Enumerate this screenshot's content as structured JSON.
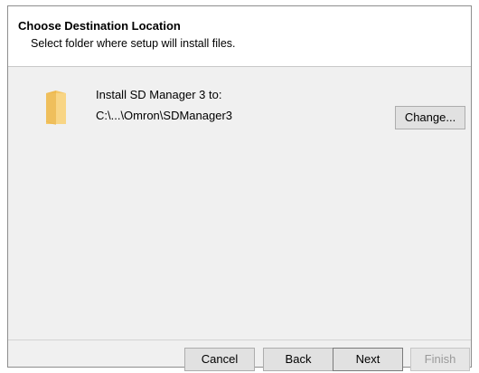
{
  "header": {
    "title": "Choose Destination Location",
    "subtitle": "Select folder where setup will install files."
  },
  "destination": {
    "label": "Install SD Manager 3 to:",
    "path": "C:\\...\\Omron\\SDManager3",
    "change_button": "Change...",
    "folder_icon": "folder-icon"
  },
  "footer": {
    "cancel": "Cancel",
    "back": "Back",
    "next": "Next",
    "finish": "Finish",
    "finish_enabled": false
  },
  "colors": {
    "dialog_background": "#f0f0f0",
    "header_background": "#ffffff",
    "folder_icon": "#f5c869",
    "disabled_text": "#9a9a9a"
  }
}
